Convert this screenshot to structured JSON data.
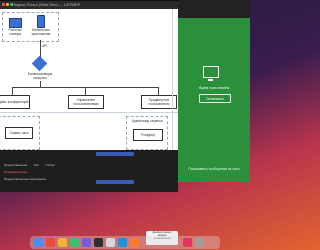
{
  "window": {
    "title": "Яндекс.Почта (Web Dev) — СЕРВЕР"
  },
  "diagram": {
    "workspace_label": "Рабочая станция",
    "mobile_label": "Мобильные приложения",
    "balancer_label": "Балансировщик нагрузки",
    "service_left_label": "Сервис конференций",
    "service_center_label": "Управление пользователями",
    "service_right_label": "Продвинутые пользователи",
    "chat_service_label": "Сервис чата",
    "storage_title": "Хранилище сервиса",
    "storage_item_label": "Postgreql",
    "arrow_label": "API"
  },
  "call_panel": {
    "status_text": "Ждём пока начнём",
    "action_button": "Остановить",
    "footer_text": "Показывать сообщения из чата"
  },
  "bottom_window": {
    "rows": [
      {
        "col1": "Предоставление",
        "col2": "Тест",
        "col3": "Статус"
      },
      {
        "col1": "Предварительно",
        "col2": "",
        "col3": ""
      },
      {
        "col1": "Предоставленные материалы",
        "col2": "",
        "col3": ""
      }
    ]
  },
  "toast": {
    "line1": "Демонстрация",
    "line2": "экрана",
    "line3": "остановлена"
  },
  "colors": {
    "accent_green": "#2c8f3b",
    "window_dark": "#1e1e1e"
  }
}
